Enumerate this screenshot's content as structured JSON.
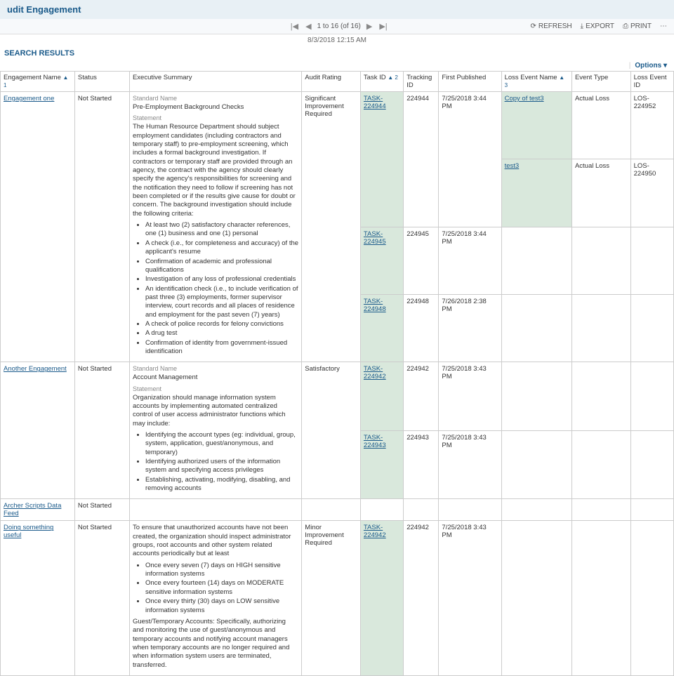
{
  "header": {
    "title": "udit Engagement"
  },
  "pager": {
    "range": "1 to 16 (of 16)"
  },
  "timestamp": "8/3/2018 12:15 AM",
  "actions": {
    "refresh": "REFRESH",
    "export": "EXPORT",
    "print": "PRINT"
  },
  "section": "SEARCH RESULTS",
  "options": "Options",
  "cols": {
    "engagement": "Engagement Name",
    "engagement_sort": "▲ 1",
    "status": "Status",
    "summary": "Executive Summary",
    "rating": "Audit Rating",
    "task": "Task ID",
    "task_sort": "▲ 2",
    "tracking": "Tracking ID",
    "published": "First Published",
    "lossname": "Loss Event Name",
    "lossname_sort": "▲ 3",
    "eventtype": "Event Type",
    "eventid": "Loss Event ID"
  },
  "rows": [
    {
      "engagement": "Engagement one",
      "status": "Not Started",
      "summary": {
        "std_label": "Standard Name",
        "std_name": "Pre-Employment Background Checks",
        "stmt_label": "Statement",
        "stmt": "The Human Resource Department should subject employment candidates (including contractors and temporary staff) to pre-employment screening, which includes a formal background investigation. If contractors or temporary staff are provided through an agency, the contract with the agency should clearly specify the agency's responsibilities for screening and the notification they need to follow if screening has not been completed or if the results give cause for doubt or concern. The background investigation should include the following criteria:",
        "bullets": [
          "At least two (2) satisfactory character references, one (1) business and one (1) personal",
          "A check (i.e., for completeness and accuracy) of the applicant's resume",
          "Confirmation of academic and professional qualifications",
          "Investigation of any loss of professional credentials",
          "An identification check (i.e., to include verification of past three (3) employments, former supervisor interview, court records and all places of residence and employment for the past seven (7) years)",
          "A check of police records for felony convictions",
          "A drug test",
          "Confirmation of identity from government-issued identification"
        ]
      },
      "rating": "Significant Improvement Required",
      "tasks": [
        {
          "task": "TASK-224944",
          "tracking": "224944",
          "pub": "7/25/2018 3:44 PM",
          "losses": [
            {
              "name": "Copy of test3",
              "type": "Actual Loss",
              "id": "LOS-224952"
            },
            {
              "name": "test3",
              "type": "Actual Loss",
              "id": "LOS-224950"
            }
          ]
        },
        {
          "task": "TASK-224945",
          "tracking": "224945",
          "pub": "7/25/2018 3:44 PM",
          "losses": []
        },
        {
          "task": "TASK-224948",
          "tracking": "224948",
          "pub": "7/26/2018 2:38 PM",
          "losses": []
        }
      ]
    },
    {
      "engagement": "Another Engagement",
      "status": "Not Started",
      "summary": {
        "std_label": "Standard Name",
        "std_name": "Account Management",
        "stmt_label": "Statement",
        "stmt": "Organization should manage information system accounts by implementing automated centralized control of user access administrator functions which may include:",
        "bullets": [
          "Identifying the account types (eg: individual, group, system, application, guest/anonymous, and temporary)",
          "Identifying authorized users of the information system and specifying access privileges",
          "Establishing, activating, modifying, disabling, and removing accounts"
        ]
      },
      "rating": "Satisfactory",
      "tasks": [
        {
          "task": "TASK-224942",
          "tracking": "224942",
          "pub": "7/25/2018 3:43 PM",
          "losses": []
        },
        {
          "task": "TASK-224943",
          "tracking": "224943",
          "pub": "7/25/2018 3:43 PM",
          "losses": []
        }
      ]
    },
    {
      "engagement": "Archer Scripts Data Feed",
      "status": "Not Started",
      "summary": null,
      "rating": "",
      "tasks": []
    },
    {
      "engagement": "Doing something useful",
      "status": "Not Started",
      "summary": {
        "stmt": "To ensure that unauthorized accounts have not been created, the organization should inspect administrator groups, root accounts and other system related accounts periodically but at least",
        "bullets": [
          "Once every seven (7) days on HIGH sensitive information systems",
          "Once every fourteen (14) days on MODERATE sensitive information systems",
          "Once every thirty (30) days on LOW sensitive information systems"
        ],
        "stmt2": "Guest/Temporary Accounts: Specifically, authorizing and monitoring the use of guest/anonymous and temporary accounts and notifying account managers when temporary accounts are no longer required and when information system users are terminated, transferred."
      },
      "rating": "Minor Improvement Required",
      "tasks": [
        {
          "task": "TASK-224942",
          "tracking": "224942",
          "pub": "7/25/2018 3:43 PM",
          "losses": []
        }
      ]
    }
  ]
}
